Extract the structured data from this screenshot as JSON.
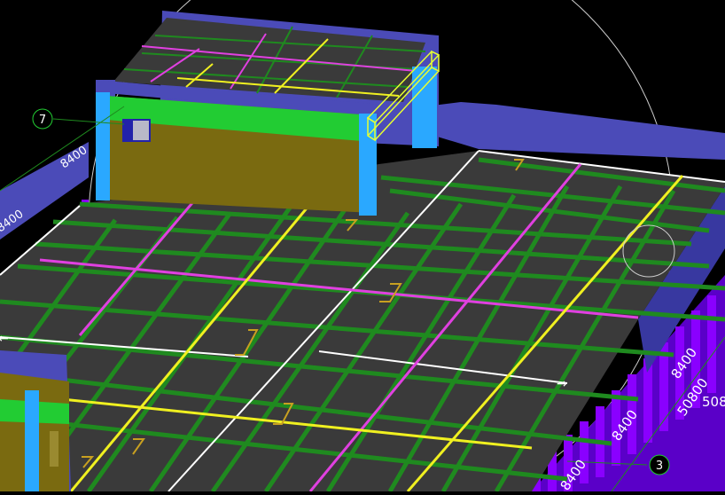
{
  "axis_markers": {
    "grid_7": "7",
    "grid_3": "3"
  },
  "dimensions": {
    "dim_1": "8400",
    "dim_2": "50800",
    "dim_3": "508",
    "dim_4": "8400",
    "dim_5": "8400",
    "dim_left_1": "8400",
    "dim_left_2": "8400"
  },
  "colors": {
    "background": "#000000",
    "slab": "#3a3a3a",
    "beam": "#1f8a1f",
    "magenta_beam": "#e040e0",
    "yellow_beam": "#f0f020",
    "white_line": "#ffffff",
    "parapet": "#4b4bb8",
    "column": "#8a00ff",
    "roof_wall": "#7a6a10",
    "roof_band": "#22cc33",
    "roof_column": "#2aa8ff",
    "selection": "#e8ff30"
  }
}
